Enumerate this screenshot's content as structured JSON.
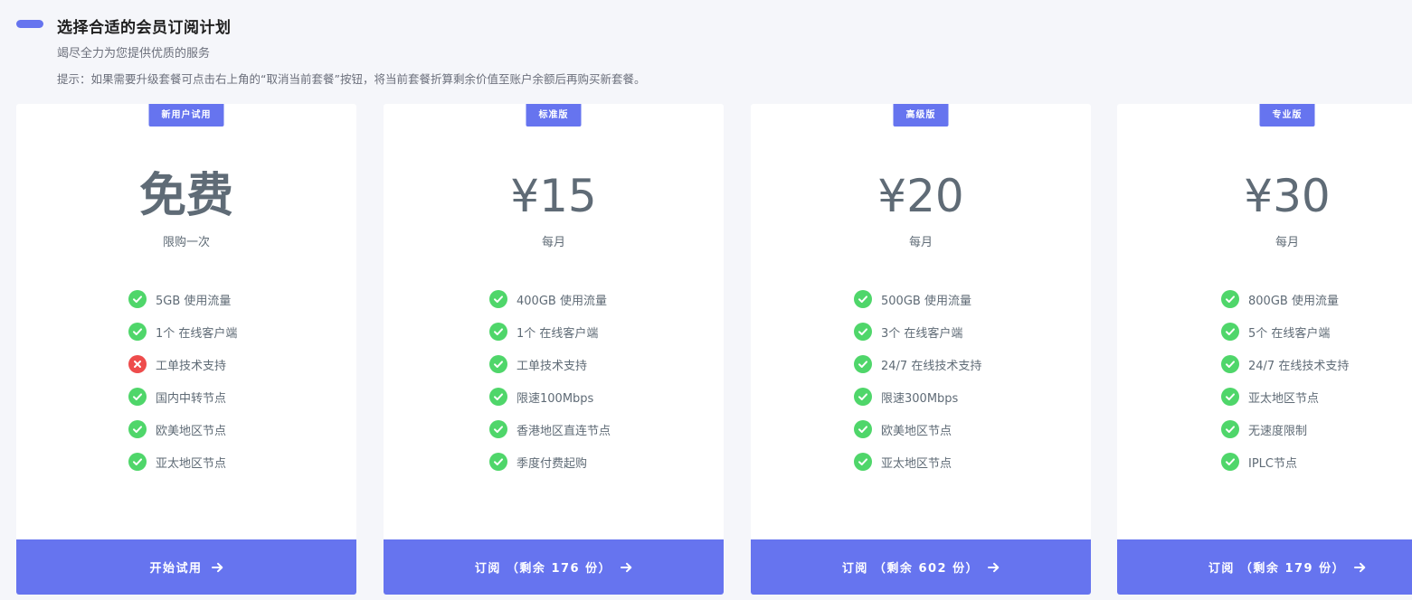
{
  "header": {
    "title": "选择合适的会员订阅计划",
    "subtitle": "竭尽全力为您提供优质的服务",
    "tip": "提示：如果需要升级套餐可点击右上角的“取消当前套餐”按钮，将当前套餐折算剩余价值至账户余额后再购买新套餐。"
  },
  "colors": {
    "accent": "#6674ef",
    "ok": "#4fd66a",
    "error": "#ee4c4c",
    "text_muted": "#5f6b76"
  },
  "plans": [
    {
      "badge": "新用户试用",
      "price": "免费",
      "period": "限购一次",
      "features": [
        {
          "text": "5GB 使用流量",
          "icon": "check-icon"
        },
        {
          "text": "1个 在线客户端",
          "icon": "check-icon"
        },
        {
          "text": "工单技术支持",
          "icon": "cross-icon"
        },
        {
          "text": "国内中转节点",
          "icon": "check-icon"
        },
        {
          "text": "欧美地区节点",
          "icon": "check-icon"
        },
        {
          "text": "亚太地区节点",
          "icon": "check-icon"
        }
      ],
      "cta": "开始试用"
    },
    {
      "badge": "标准版",
      "price": "¥15",
      "period": "每月",
      "features": [
        {
          "text": "400GB 使用流量",
          "icon": "check-icon"
        },
        {
          "text": "1个 在线客户端",
          "icon": "check-icon"
        },
        {
          "text": "工单技术支持",
          "icon": "check-icon"
        },
        {
          "text": "限速100Mbps",
          "icon": "check-icon"
        },
        {
          "text": "香港地区直连节点",
          "icon": "check-icon"
        },
        {
          "text": "季度付费起购",
          "icon": "check-icon"
        }
      ],
      "cta": "订阅 （剩余 176 份）"
    },
    {
      "badge": "高级版",
      "price": "¥20",
      "period": "每月",
      "features": [
        {
          "text": "500GB 使用流量",
          "icon": "check-icon"
        },
        {
          "text": "3个 在线客户端",
          "icon": "check-icon"
        },
        {
          "text": "24/7 在线技术支持",
          "icon": "check-icon"
        },
        {
          "text": "限速300Mbps",
          "icon": "check-icon"
        },
        {
          "text": "欧美地区节点",
          "icon": "check-icon"
        },
        {
          "text": "亚太地区节点",
          "icon": "check-icon"
        }
      ],
      "cta": "订阅 （剩余 602 份）"
    },
    {
      "badge": "专业版",
      "price": "¥30",
      "period": "每月",
      "features": [
        {
          "text": "800GB 使用流量",
          "icon": "check-icon"
        },
        {
          "text": "5个 在线客户端",
          "icon": "check-icon"
        },
        {
          "text": "24/7 在线技术支持",
          "icon": "check-icon"
        },
        {
          "text": "亚太地区节点",
          "icon": "check-icon"
        },
        {
          "text": "无速度限制",
          "icon": "check-icon"
        },
        {
          "text": "IPLC节点",
          "icon": "check-icon"
        }
      ],
      "cta": "订阅 （剩余 179 份）"
    }
  ]
}
